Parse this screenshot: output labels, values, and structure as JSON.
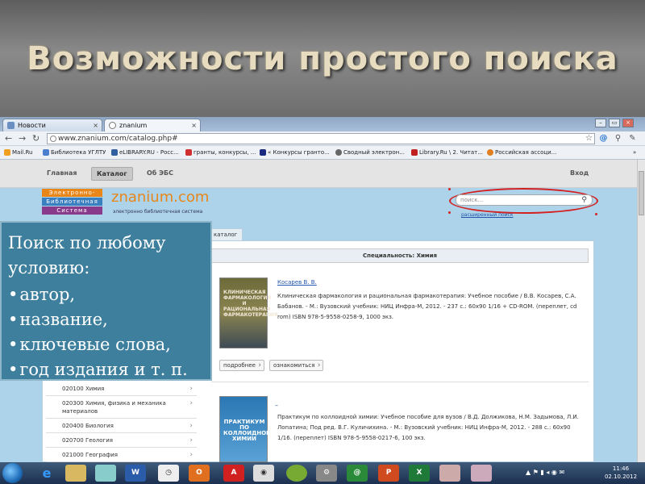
{
  "slide": {
    "title": "Возможности простого поиска"
  },
  "browser": {
    "tabs": [
      "Новости",
      "znanium"
    ],
    "url": "www.znanium.com/catalog.php#",
    "bookmarks": [
      "Mail.Ru",
      "Библиотека УГЛТУ",
      "eLIBRARY.RU - Росс...",
      "гранты, конкурсы, ...",
      "« Конкурсы гранто...",
      "Сводный электрон...",
      "Library.Ru \\ 2. Читат...",
      "Российская ассоци..."
    ]
  },
  "site": {
    "nav": [
      "Главная",
      "Каталог",
      "Об ЭБС"
    ],
    "login": "Вход",
    "logo_rows": [
      "Электронно-",
      "Библиотечная",
      "Система"
    ],
    "brand": "znanium.com",
    "brand_subtitle": "электронно библиотечная система",
    "search_placeholder": "поиск...",
    "advanced_search": "расширенный поиск",
    "catalog_tab": "каталог",
    "specialty": "Специальность: Химия",
    "books": [
      {
        "author": "Косарев В. В.",
        "description": "Клиническая фармакология и рациональная фармакотерапия: Учебное пособие / В.В. Косарев, С.А. Бабанов. - М.: Вузовский учебник: НИЦ Инфра-М, 2012. - 237 с.: 60x90 1/16 + CD-ROM. (переплет, cd rom) ISBN 978-5-9558-0258-9, 1000 экз.",
        "cover_text": "КЛИНИЧЕСКАЯ ФАРМАКОЛОГИЯ И РАЦИОНАЛЬНАЯ ФАРМАКОТЕРАПИЯ"
      },
      {
        "author": "–",
        "description": "Практикум по коллоидной химии: Учебное пособие для вузов / В.Д. Должикова, Н.М. Задымова, Л.И. Лопатина; Под ред. В.Г. Куличихина. - М.: Вузовский учебник: НИЦ Инфра-М, 2012. - 288 с.: 60x90 1/16. (переплет) ISBN 978-5-9558-0217-6, 100 экз.",
        "cover_text": "ПРАКТИКУМ ПО КОЛЛОИДНОЙ ХИМИИ"
      }
    ],
    "buttons": [
      "подробнее",
      "ознакомиться"
    ],
    "categories": [
      "020100 Химия",
      "020300 Химия, физика и механика материалов",
      "020400 Биология",
      "020700 Геология",
      "021000 География"
    ]
  },
  "overlay": {
    "heading": "Поиск по любому условию:",
    "items": [
      "автор,",
      "название,",
      "ключевые слова,",
      "год издания и т. п."
    ]
  },
  "taskbar": {
    "time": "11:46",
    "date": "02.10.2012"
  }
}
